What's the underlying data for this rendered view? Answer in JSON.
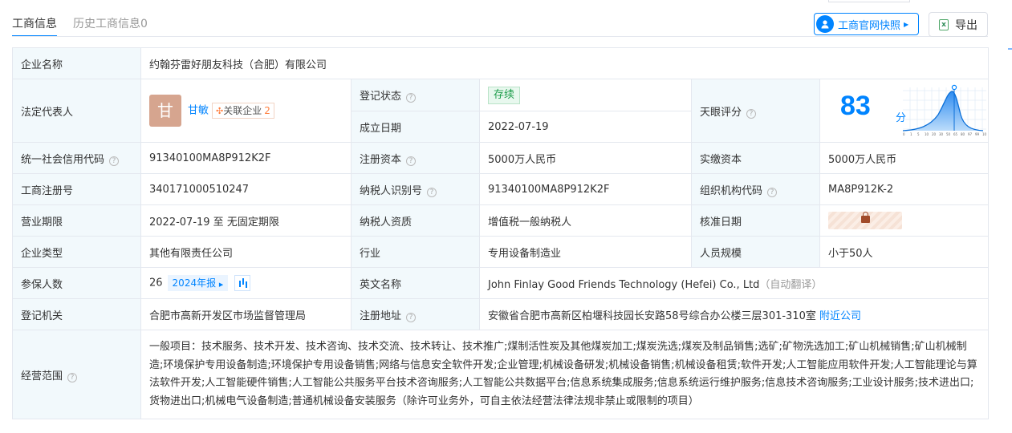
{
  "tabs": [
    {
      "label": "工商信息"
    },
    {
      "label": "历史工商信息0"
    }
  ],
  "actions": {
    "snapshot_label": "工商官网快照",
    "export_label": "导出"
  },
  "labels": {
    "company_name": "企业名称",
    "legal_rep": "法定代表人",
    "reg_status": "登记状态",
    "established": "成立日期",
    "tianyan_score": "天眼评分",
    "credit_code": "统一社会信用代码",
    "reg_capital": "注册资本",
    "paid_capital": "实缴资本",
    "biz_reg_no": "工商注册号",
    "taxpayer_id": "纳税人识别号",
    "org_code": "组织机构代码",
    "biz_term": "营业期限",
    "taxpayer_qual": "纳税人资质",
    "approval_date": "核准日期",
    "company_type": "企业类型",
    "industry": "行业",
    "staff_size": "人员规模",
    "insured": "参保人数",
    "english_name": "英文名称",
    "reg_authority": "登记机关",
    "reg_address": "注册地址",
    "biz_scope": "经营范围"
  },
  "company": {
    "name": "约翰芬雷好朋友科技（合肥）有限公司",
    "avatar_char": "甘",
    "legal_rep_name": "甘敏",
    "related_label": "关联企业",
    "related_count": "2",
    "reg_status": "存续",
    "established": "2022-07-19",
    "score": "83",
    "score_unit": "分",
    "score_axis": [
      "0",
      "1",
      "5",
      "10",
      "20",
      "30",
      "50",
      "65",
      "80",
      "97",
      "99",
      "100"
    ],
    "credit_code": "91340100MA8P912K2F",
    "reg_capital": "5000万人民币",
    "paid_capital": "5000万人民币",
    "biz_reg_no": "340171000510247",
    "taxpayer_id": "91340100MA8P912K2F",
    "org_code": "MA8P912K-2",
    "biz_term": "2022-07-19 至 无固定期限",
    "taxpayer_qual": "增值税一般纳税人",
    "company_type": "其他有限责任公司",
    "industry": "专用设备制造业",
    "staff_size": "小于50人",
    "insured": "26",
    "insured_year_tag": "2024年报",
    "english_name": "John Finlay Good Friends Technology (Hefei) Co., Ltd",
    "english_note": "（自动翻译）",
    "reg_authority": "合肥市高新开发区市场监督管理局",
    "reg_address": "安徽省合肥市高新区柏堰科技园长安路58号综合办公楼三层301-310室",
    "nearby_label": "附近公司",
    "biz_scope": "一般项目：技术服务、技术开发、技术咨询、技术交流、技术转让、技术推广;煤制活性炭及其他煤炭加工;煤炭洗选;煤炭及制品销售;选矿;矿物洗选加工;矿山机械销售;矿山机械制造;环境保护专用设备制造;环境保护专用设备销售;网络与信息安全软件开发;企业管理;机械设备研发;机械设备销售;机械设备租赁;软件开发;人工智能应用软件开发;人工智能理论与算法软件开发;人工智能硬件销售;人工智能公共服务平台技术咨询服务;人工智能公共数据平台;信息系统集成服务;信息系统运行维护服务;信息技术咨询服务;工业设计服务;技术进出口;货物进出口;机械电气设备制造;普通机械设备安装服务（除许可业务外，可自主依法经营法律法规非禁止或限制的项目）"
  },
  "colors": {
    "accent": "#0084ff",
    "label_bg": "#f2f9fc",
    "status_green": "#1c9c4a"
  }
}
